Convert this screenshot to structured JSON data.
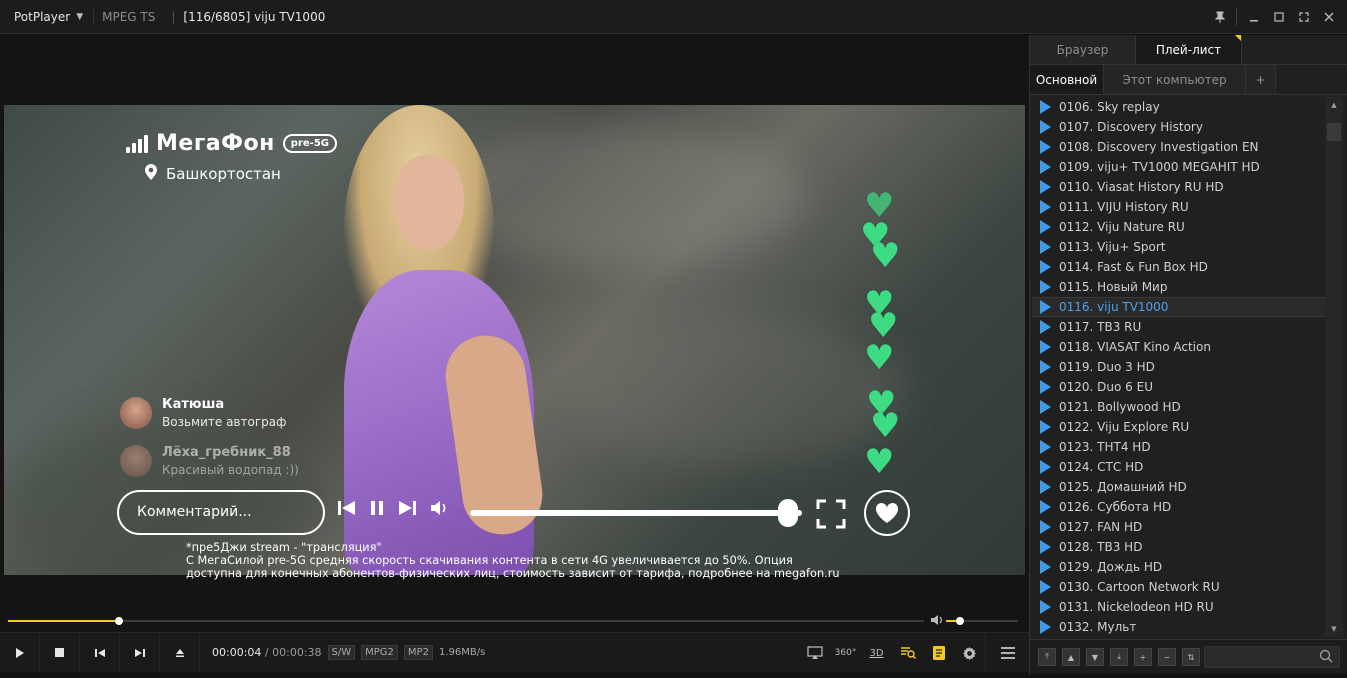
{
  "titlebar": {
    "app_name": "PotPlayer",
    "format": "MPEG TS",
    "title": "[116/6805] viju TV1000"
  },
  "video": {
    "brand": "МегаФон",
    "brand_badge": "pre-5G",
    "region": "Башкортостан",
    "comments": [
      {
        "name": "Катюша",
        "text": "Возьмите автограф"
      },
      {
        "name": "Лёха_гребник_88",
        "text": "Красивый водопад :))"
      }
    ],
    "comment_placeholder": "Комментарий...",
    "disclaimer": [
      "*пре5Джи  stream - \"трансляция\"",
      "С МегаСилой pre-5G средняя скорость скачивания контента в сети 4G увеличивается до 50%. Опция",
      "доступна для конечных абонентов-физических лиц, стоимость зависит от тарифа, подробнее на megafon.ru"
    ]
  },
  "playback": {
    "progress": 0.121,
    "volume": 0.2
  },
  "controlbar": {
    "current_time": "00:00:04",
    "separator": "/",
    "duration": "00:00:38",
    "decoder": "S/W",
    "video_codec": "MPG2",
    "audio_codec": "MP2",
    "bitrate": "1.96MB/s",
    "label_360": "360°",
    "label_3d": "3D"
  },
  "sidebar": {
    "tabs": [
      "Браузер",
      "Плей-лист"
    ],
    "subtabs": [
      "Основной",
      "Этот компьютер",
      "+"
    ],
    "playlist": [
      "0106. Sky replay",
      "0107. Discovery History",
      "0108. Discovery Investigation EN",
      "0109. viju+ TV1000 MEGAHIT HD",
      "0110. Viasat History RU HD",
      "0111. VIJU History RU",
      "0112. Viju Nature RU",
      "0113. Viju+ Sport",
      "0114. Fast & Fun Box HD",
      "0115. Новый Мир",
      "0116. viju TV1000",
      "0117. ТВ3 RU",
      "0118. VIASAT Kino Action",
      "0119. Duo 3 HD",
      "0120. Duo 6 EU",
      "0121. Bollywood HD",
      "0122. Viju Explore RU",
      "0123. ТНТ4 HD",
      "0124. СТС HD",
      "0125. Домашний HD",
      "0126. Суббота HD",
      "0127. FAN HD",
      "0128. ТВ3 HD",
      "0129. Дождь HD",
      "0130. Cartoon Network RU",
      "0131. Nickelodeon HD RU",
      "0132. Мульт"
    ],
    "current_index": 10
  },
  "colors": {
    "accent": "#f2cb1d",
    "playlist_icon": "#3d9be9",
    "current_item": "#4aa3f0",
    "hearts": "#3ddc84"
  }
}
